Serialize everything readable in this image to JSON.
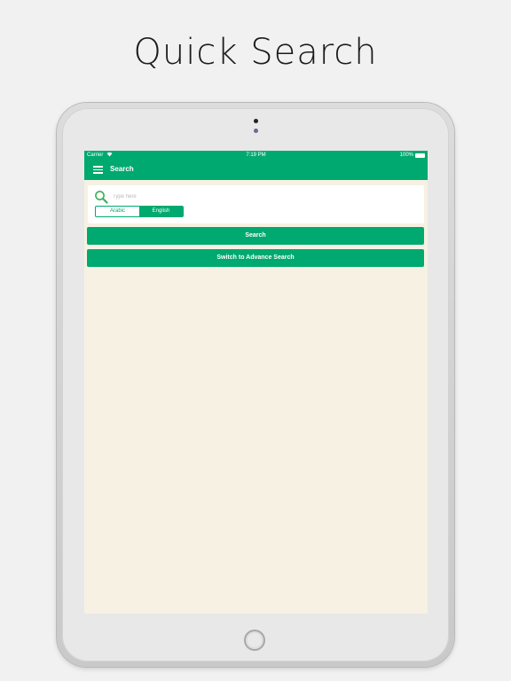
{
  "headline": "Quick Search",
  "status_bar": {
    "carrier": "Carrier",
    "time": "7:19 PM",
    "battery": "100%",
    "wifi_icon": "wifi-icon",
    "battery_icon": "battery-icon"
  },
  "navbar": {
    "menu_icon": "hamburger-menu-icon",
    "title": "Search"
  },
  "search": {
    "icon": "search-icon",
    "placeholder": "Type here",
    "value": "",
    "language_options": [
      "Arabic",
      "English"
    ],
    "selected_language": "English"
  },
  "buttons": {
    "search_label": "Search",
    "switch_label": "Switch to Advance Search"
  },
  "colors": {
    "accent": "#00a96f",
    "content_background": "#f6f1e3",
    "page_background": "#f1f1f1"
  }
}
